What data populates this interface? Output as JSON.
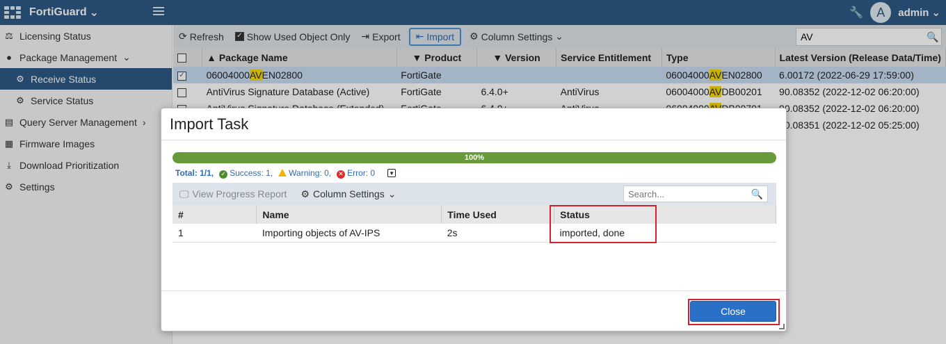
{
  "topbar": {
    "brand": "FortiGuard",
    "avatar_letter": "A",
    "user": "admin"
  },
  "sidebar": {
    "items": [
      {
        "label": "Licensing Status",
        "icon": "license-icon"
      },
      {
        "label": "Package Management",
        "icon": "person-icon"
      },
      {
        "label": "Receive Status",
        "icon": "gear-icon"
      },
      {
        "label": "Service Status",
        "icon": "gear-icon"
      },
      {
        "label": "Query Server Management",
        "icon": "server-icon"
      },
      {
        "label": "Firmware Images",
        "icon": "stack-icon"
      },
      {
        "label": "Download Prioritization",
        "icon": "download-icon"
      },
      {
        "label": "Settings",
        "icon": "gear-icon"
      }
    ]
  },
  "toolbar": {
    "refresh": "Refresh",
    "show_used": "Show Used Object Only",
    "export": "Export",
    "import": "Import",
    "column_settings": "Column Settings",
    "search_value": "AV"
  },
  "table": {
    "headers": [
      "Package Name",
      "Product",
      "Version",
      "Service Entitlement",
      "Type",
      "Latest Version (Release Data/Time)"
    ],
    "rows": [
      {
        "pre": "06004000",
        "hl": "AV",
        "post": "EN02800",
        "product": "FortiGate",
        "version": "",
        "service": "",
        "type_pre": "06004000",
        "type_hl": "AV",
        "type_post": "EN02800",
        "latest": "6.00172 (2022-06-29 17:59:00)"
      },
      {
        "name": "AntiVirus Signature Database (Active)",
        "product": "FortiGate",
        "version": "6.4.0+",
        "service": "AntiVirus",
        "type_pre": "06004000",
        "type_hl": "AV",
        "type_post": "DB00201",
        "latest": "90.08352 (2022-12-02 06:20:00)"
      },
      {
        "name": "AntiVirus Signature Database (Extended)",
        "product": "FortiGate",
        "version": "6.4.0+",
        "service": "AntiVirus",
        "type_pre": "06004000",
        "type_hl": "AV",
        "type_post": "DB00701",
        "latest": "90.08352 (2022-12-02 06:20:00)"
      },
      {
        "latest": "90.08351 (2022-12-02 05:25:00)"
      }
    ]
  },
  "modal": {
    "title": "Import Task",
    "progress_label": "100%",
    "progress": 1.0,
    "total": "Total: 1/1,",
    "success": "Success: 1,",
    "warning": "Warning: 0,",
    "error": "Error: 0",
    "view_progress": "View Progress Report",
    "column_settings": "Column Settings",
    "search_placeholder": "Search...",
    "headers": [
      "#",
      "Name",
      "Time Used",
      "Status"
    ],
    "rows": [
      {
        "num": "1",
        "name": "Importing objects of AV-IPS",
        "time": "2s",
        "status": "imported, done"
      }
    ],
    "close": "Close"
  }
}
